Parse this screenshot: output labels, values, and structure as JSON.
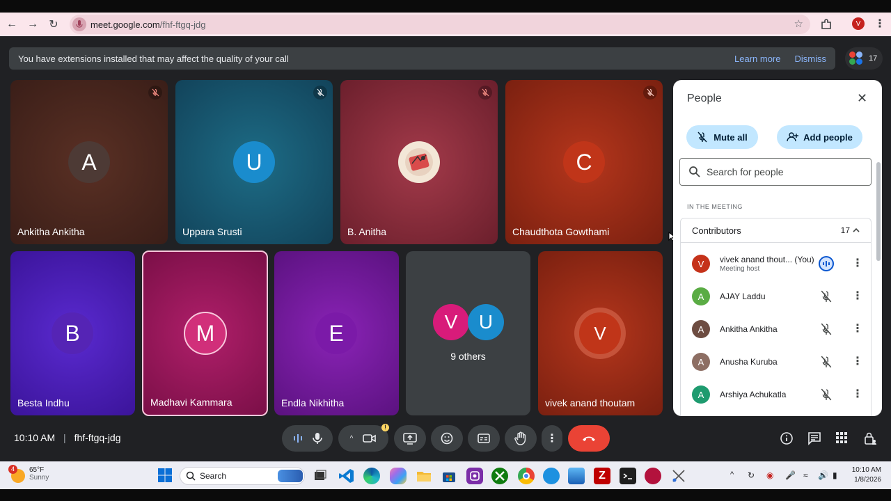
{
  "browser": {
    "url_host": "meet.google.com",
    "url_path": "/fhf-ftgq-jdg",
    "profile_initial": "V"
  },
  "notice": {
    "message": "You have extensions installed that may affect the quality of your call",
    "learn_more": "Learn more",
    "dismiss": "Dismiss",
    "participant_count": "17"
  },
  "tiles": [
    {
      "initial": "A",
      "name": "Ankitha Ankitha"
    },
    {
      "initial": "U",
      "name": "Uppara Srusti"
    },
    {
      "initial": "",
      "name": "B. Anitha"
    },
    {
      "initial": "C",
      "name": "Chaudthota Gowthami"
    },
    {
      "initial": "B",
      "name": "Besta Indhu"
    },
    {
      "initial": "M",
      "name": "Madhavi Kammara"
    },
    {
      "initial": "E",
      "name": "Endla Nikhitha"
    },
    {
      "initial": "V",
      "name": "vivek anand thoutam"
    }
  ],
  "others": {
    "initials": [
      "V",
      "U"
    ],
    "label": "9 others"
  },
  "people_panel": {
    "title": "People",
    "mute_all": "Mute all",
    "add_people": "Add people",
    "search_placeholder": "Search for people",
    "section": "IN THE MEETING",
    "group": "Contributors",
    "group_count": "17",
    "people": [
      {
        "initial": "V",
        "name": "vivek anand thout...",
        "you": "(You)",
        "role": "Meeting host",
        "color": "#c5321a"
      },
      {
        "initial": "A",
        "name": "AJAY Laddu",
        "you": "",
        "role": "",
        "color": "#5aac44"
      },
      {
        "initial": "A",
        "name": "Ankitha Ankitha",
        "you": "",
        "role": "",
        "color": "#6d4c41"
      },
      {
        "initial": "A",
        "name": "Anusha Kuruba",
        "you": "",
        "role": "",
        "color": "#8d6e63"
      },
      {
        "initial": "A",
        "name": "Arshiya Achukatla",
        "you": "",
        "role": "",
        "color": "#1e9b6f"
      }
    ]
  },
  "footer": {
    "time": "10:10 AM",
    "separator": "|",
    "meeting_code": "fhf-ftgq-jdg"
  },
  "taskbar": {
    "weather_temp": "65°F",
    "weather_desc": "Sunny",
    "weather_badge": "4",
    "search": "Search",
    "clock_time": "10:10 AM",
    "clock_date": "1/8/2026"
  }
}
